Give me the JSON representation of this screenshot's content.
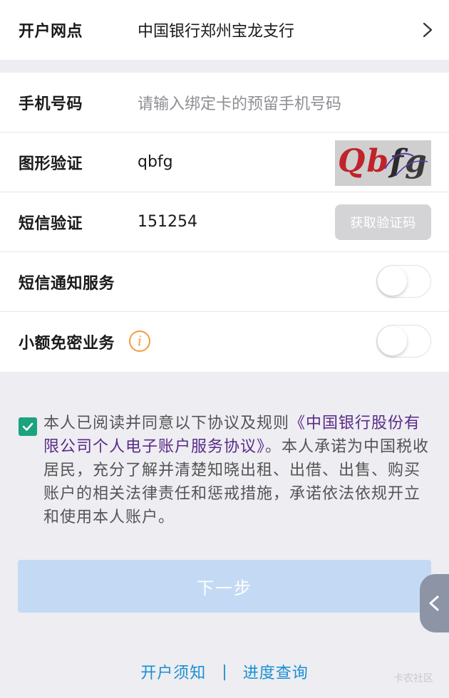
{
  "branch": {
    "label": "开户网点",
    "value": "中国银行郑州宝龙支行"
  },
  "form": {
    "phone": {
      "label": "手机号码",
      "placeholder": "请输入绑定卡的预留手机号码"
    },
    "captcha": {
      "label": "图形验证",
      "value": "qbfg",
      "image_text": "Qbfg"
    },
    "sms": {
      "label": "短信验证",
      "value": "151254",
      "button_label": "获取验证码"
    },
    "sms_notify": {
      "label": "短信通知服务",
      "enabled": false
    },
    "small_pay": {
      "label": "小额免密业务",
      "info_icon_glyph": "i",
      "enabled": false
    }
  },
  "agreement": {
    "checked": true,
    "text_before": "本人已阅读并同意以下协议及规则",
    "link_text": "《中国银行股份有限公司个人电子账户服务协议》",
    "text_after": "。本人承诺为中国税收居民，充分了解并清楚知晓出租、出借、出售、购买账户的相关法律责任和惩戒措施，承诺依法依规开立和使用本人账户。"
  },
  "next_button": {
    "label": "下一步"
  },
  "footer": {
    "link1": "开户须知",
    "separator": "|",
    "link2": "进度查询"
  },
  "watermark": "卡农社区",
  "colors": {
    "accent_green": "#1aa37f",
    "link_purple": "#5a2a86",
    "link_blue": "#1a8fd0",
    "info_orange": "#f39c3c",
    "next_button_disabled": "#c4daf4"
  },
  "icons": {
    "branch_chevron": "chevron-right-icon",
    "checkbox": "check-icon",
    "side_tab": "chevron-left-icon",
    "info": "info-icon"
  }
}
